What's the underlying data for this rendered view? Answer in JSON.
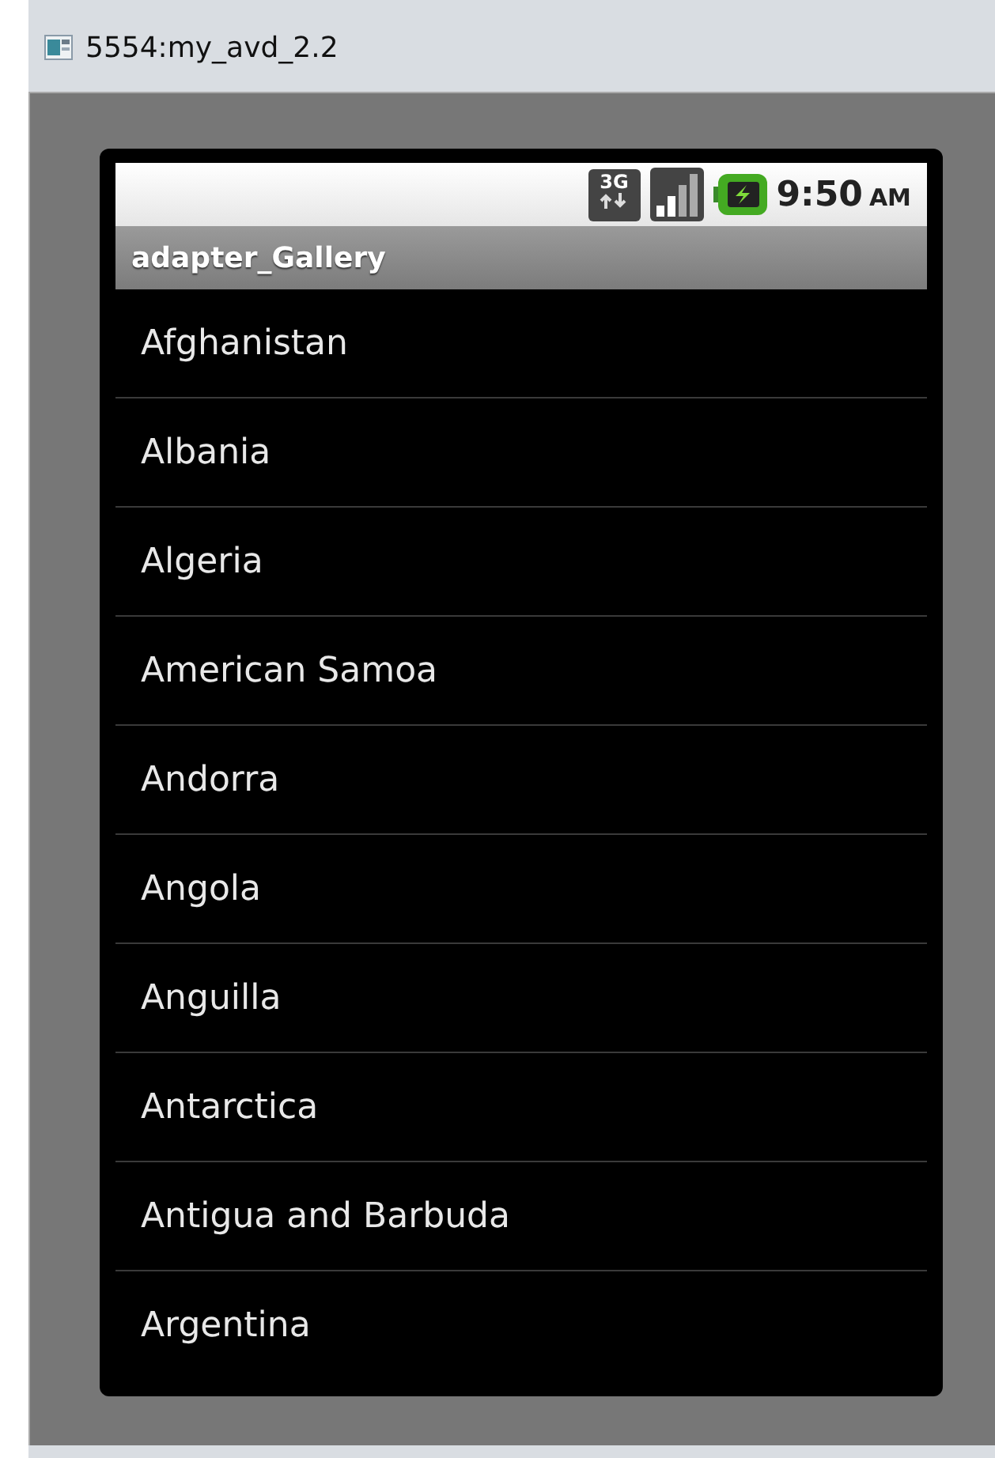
{
  "window": {
    "title": "5554:my_avd_2.2"
  },
  "status_bar": {
    "network": "3G",
    "time": "9:50",
    "meridiem": "AM"
  },
  "app": {
    "title": "adapter_Gallery"
  },
  "list": {
    "items": [
      {
        "label": "Afghanistan"
      },
      {
        "label": "Albania"
      },
      {
        "label": "Algeria"
      },
      {
        "label": "American Samoa"
      },
      {
        "label": "Andorra"
      },
      {
        "label": "Angola"
      },
      {
        "label": "Anguilla"
      },
      {
        "label": "Antarctica"
      },
      {
        "label": "Antigua and Barbuda"
      },
      {
        "label": "Argentina"
      }
    ]
  }
}
